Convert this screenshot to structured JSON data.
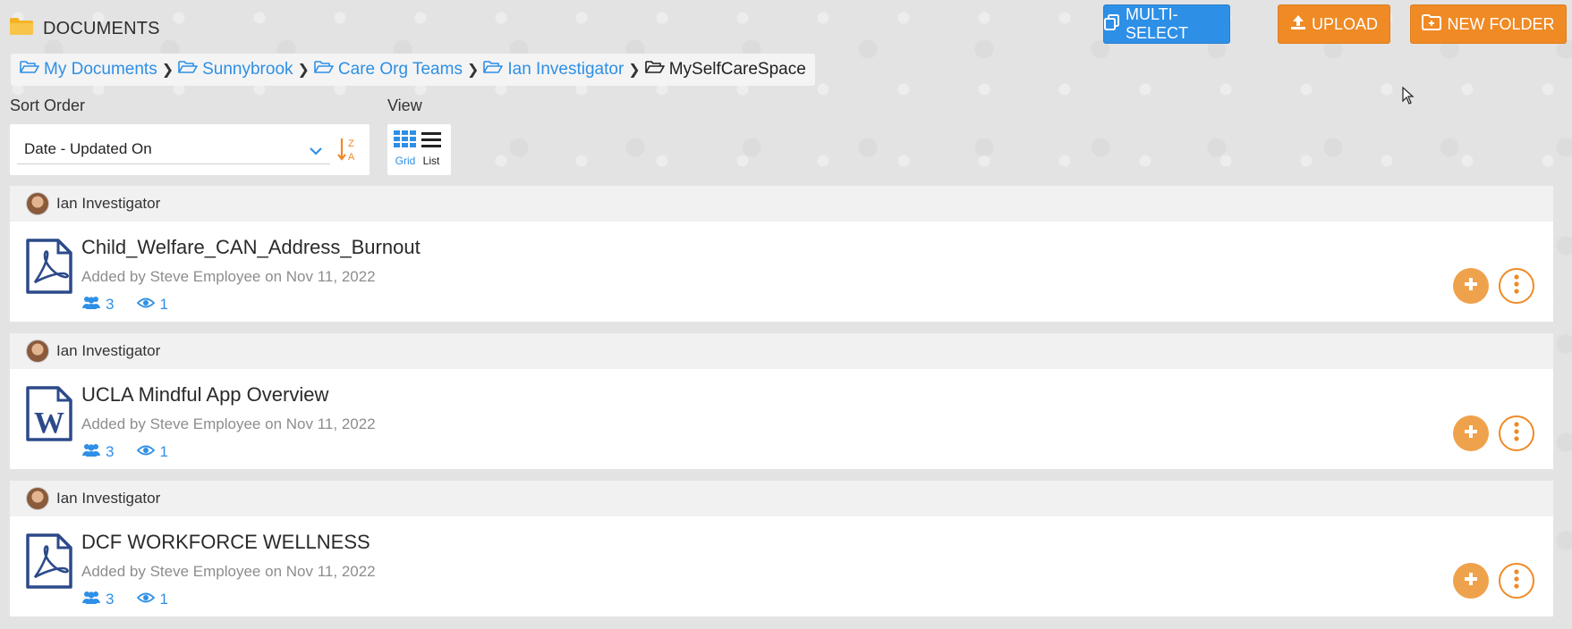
{
  "header": {
    "title": "DOCUMENTS",
    "multi_select_label": "MULTI-SELECT",
    "upload_label": "UPLOAD",
    "new_folder_label": "NEW FOLDER"
  },
  "breadcrumb": {
    "items": [
      "My Documents",
      "Sunnybrook",
      "Care Org Teams",
      "Ian Investigator",
      "MySelfCareSpace"
    ]
  },
  "sort": {
    "label": "Sort Order",
    "selected": "Date - Updated On"
  },
  "view": {
    "label": "View",
    "grid_label": "Grid",
    "list_label": "List"
  },
  "documents": [
    {
      "owner": "Ian Investigator",
      "name": "Child_Welfare_CAN_Address_Burnout",
      "type": "pdf",
      "added_by_prefix": "Added by",
      "added_by": "Steve Employee",
      "date_prefix": "on",
      "date": "Nov 11, 2022",
      "shares": "3",
      "views": "1"
    },
    {
      "owner": "Ian Investigator",
      "name": "UCLA Mindful App Overview",
      "type": "word",
      "added_by_prefix": "Added by",
      "added_by": "Steve Employee",
      "date_prefix": "on",
      "date": "Nov 11, 2022",
      "shares": "3",
      "views": "1"
    },
    {
      "owner": "Ian Investigator",
      "name": "DCF WORKFORCE WELLNESS",
      "type": "pdf",
      "added_by_prefix": "Added by",
      "added_by": "Steve Employee",
      "date_prefix": "on",
      "date": "Nov 11, 2022",
      "shares": "3",
      "views": "1"
    }
  ],
  "colors": {
    "accent_blue": "#2e8fe6",
    "accent_orange": "#ef8a25",
    "file_icon": "#2c4a8a"
  },
  "icons": [
    "folder-icon",
    "copy-icon",
    "upload-icon",
    "folder-plus-icon",
    "folder-open-icon",
    "chevron-right-icon",
    "chevron-down-icon",
    "sort-az-icon",
    "grid-view-icon",
    "list-view-icon",
    "pdf-file-icon",
    "word-file-icon",
    "users-icon",
    "eye-icon",
    "plus-icon",
    "more-vertical-icon"
  ]
}
